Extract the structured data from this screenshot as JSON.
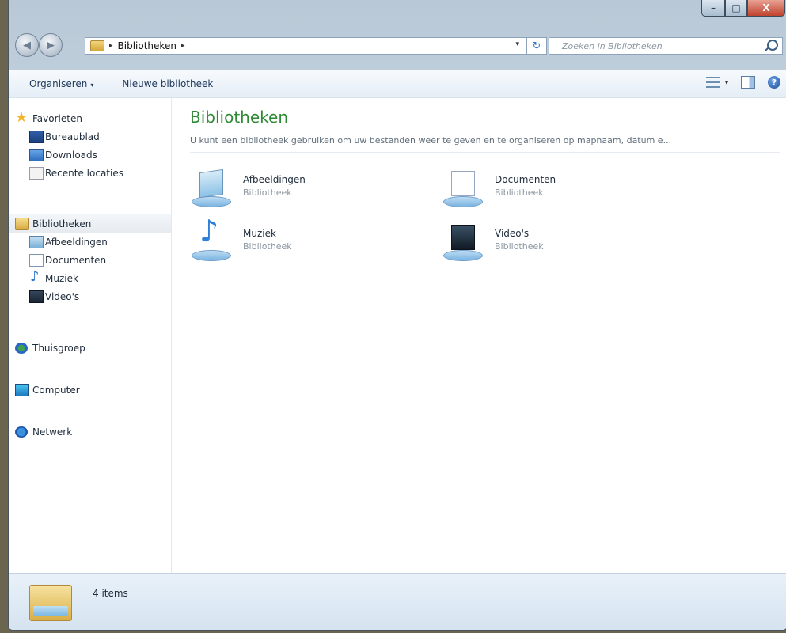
{
  "window": {
    "controls": {
      "minimize": "–",
      "maximize": "□",
      "close": "X"
    }
  },
  "address": {
    "separator": "▸",
    "path": "Bibliotheken",
    "trailing_separator": "▸",
    "dropdown": "▾",
    "refresh": "↻",
    "search_placeholder": "Zoeken in Bibliotheken"
  },
  "toolbar": {
    "organize_label": "Organiseren",
    "organize_arrow": "▾",
    "new_library_label": "Nieuwe bibliotheek",
    "views_arrow": "▾",
    "help_label": "?"
  },
  "sidebar": {
    "favorites": {
      "label": "Favorieten",
      "items": [
        {
          "label": "Bureaublad",
          "icon": "desktop-icon"
        },
        {
          "label": "Downloads",
          "icon": "downloads-icon"
        },
        {
          "label": "Recente locaties",
          "icon": "recent-icon"
        }
      ]
    },
    "libraries": {
      "label": "Bibliotheken",
      "items": [
        {
          "label": "Afbeeldingen",
          "icon": "pictures-icon"
        },
        {
          "label": "Documenten",
          "icon": "documents-icon"
        },
        {
          "label": "Muziek",
          "icon": "music-icon"
        },
        {
          "label": "Video's",
          "icon": "video-icon"
        }
      ]
    },
    "homegroup": "Thuisgroep",
    "computer": "Computer",
    "network": "Netwerk"
  },
  "main": {
    "title": "Bibliotheken",
    "description": "U kunt een bibliotheek gebruiken om uw bestanden weer te geven en te organiseren op mapnaam, datum e...",
    "libraries": [
      {
        "name": "Afbeeldingen",
        "type": "Bibliotheek",
        "icon": "pictures-library-icon"
      },
      {
        "name": "Documenten",
        "type": "Bibliotheek",
        "icon": "documents-library-icon"
      },
      {
        "name": "Muziek",
        "type": "Bibliotheek",
        "icon": "music-library-icon"
      },
      {
        "name": "Video's",
        "type": "Bibliotheek",
        "icon": "video-library-icon"
      }
    ]
  },
  "status": {
    "item_count": "4 items"
  },
  "colors": {
    "accent_title": "#2e8a34",
    "text": "#1e2b3a",
    "muted": "#8a96a2"
  }
}
